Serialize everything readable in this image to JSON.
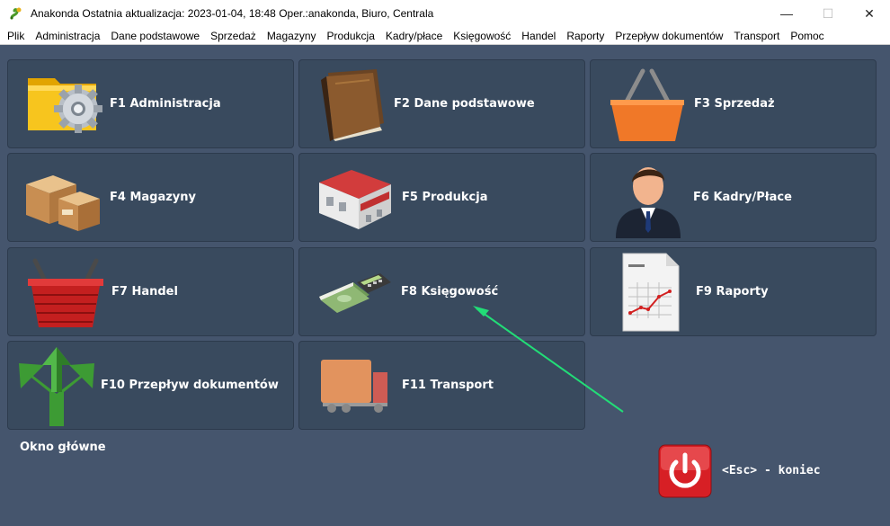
{
  "window": {
    "title": "Anakonda Ostatnia aktualizacja: 2023-01-04, 18:48 Oper.:anakonda, Biuro, Centrala",
    "minimize": "—",
    "maximize": "☐",
    "close": "✕"
  },
  "menu": [
    "Plik",
    "Administracja",
    "Dane podstawowe",
    "Sprzedaż",
    "Magazyny",
    "Produkcja",
    "Kadry/płace",
    "Księgowość",
    "Handel",
    "Raporty",
    "Przepływ dokumentów",
    "Transport",
    "Pomoc"
  ],
  "tiles": [
    {
      "label": "F1 Administracja",
      "icon": "gear-folder-icon"
    },
    {
      "label": "F2 Dane podstawowe",
      "icon": "book-icon"
    },
    {
      "label": "F3 Sprzedaż",
      "icon": "shopping-basket-icon"
    },
    {
      "label": "F4 Magazyny",
      "icon": "boxes-icon"
    },
    {
      "label": "F5 Produkcja",
      "icon": "factory-icon"
    },
    {
      "label": "F6 Kadry/Płace",
      "icon": "person-icon"
    },
    {
      "label": "F7 Handel",
      "icon": "red-basket-icon"
    },
    {
      "label": "F8 Księgowość",
      "icon": "money-calculator-icon"
    },
    {
      "label": "F9 Raporty",
      "icon": "report-icon"
    },
    {
      "label": "F10 Przepływ dokumentów",
      "icon": "split-arrows-icon"
    },
    {
      "label": "F11 Transport",
      "icon": "truck-icon"
    }
  ],
  "status": {
    "label": "Okno główne"
  },
  "exit": {
    "label": "<Esc> - koniec",
    "icon": "power-icon"
  },
  "colors": {
    "background": "#45556d",
    "tile": "#394a5e",
    "annotation_arrow": "#22dd77"
  },
  "icons": {
    "app": "snake-app-icon"
  }
}
